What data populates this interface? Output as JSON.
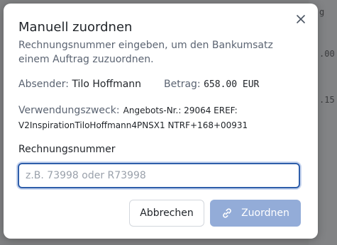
{
  "background": {
    "partial_texts": [
      "g",
      ".00",
      ".15"
    ]
  },
  "modal": {
    "title": "Manuell zuordnen",
    "close_icon": "close-icon",
    "subtitle": "Rechnungsnummer eingeben, um den Bankumsatz einem Auftrag zuzuordnen.",
    "sender_label": "Absender:",
    "sender_value": "Tilo Hoffmann",
    "amount_label": "Betrag:",
    "amount_value": "658.00 EUR",
    "purpose_label": "Verwendungszweck:",
    "purpose_value": "Angebots-Nr.: 29064 EREF: V2InspirationTiloHoffmann4PNSX1 NTRF+168+00931",
    "invoice_label": "Rechnungsnummer",
    "invoice_placeholder": "z.B. 73998 oder R73998",
    "invoice_value": "",
    "cancel_label": "Abbrechen",
    "assign_label": "Zuordnen",
    "assign_icon": "link-icon"
  },
  "colors": {
    "primary": "#2e5eaa",
    "primary_disabled": "#93acd8",
    "overlay": "#7f8082"
  }
}
